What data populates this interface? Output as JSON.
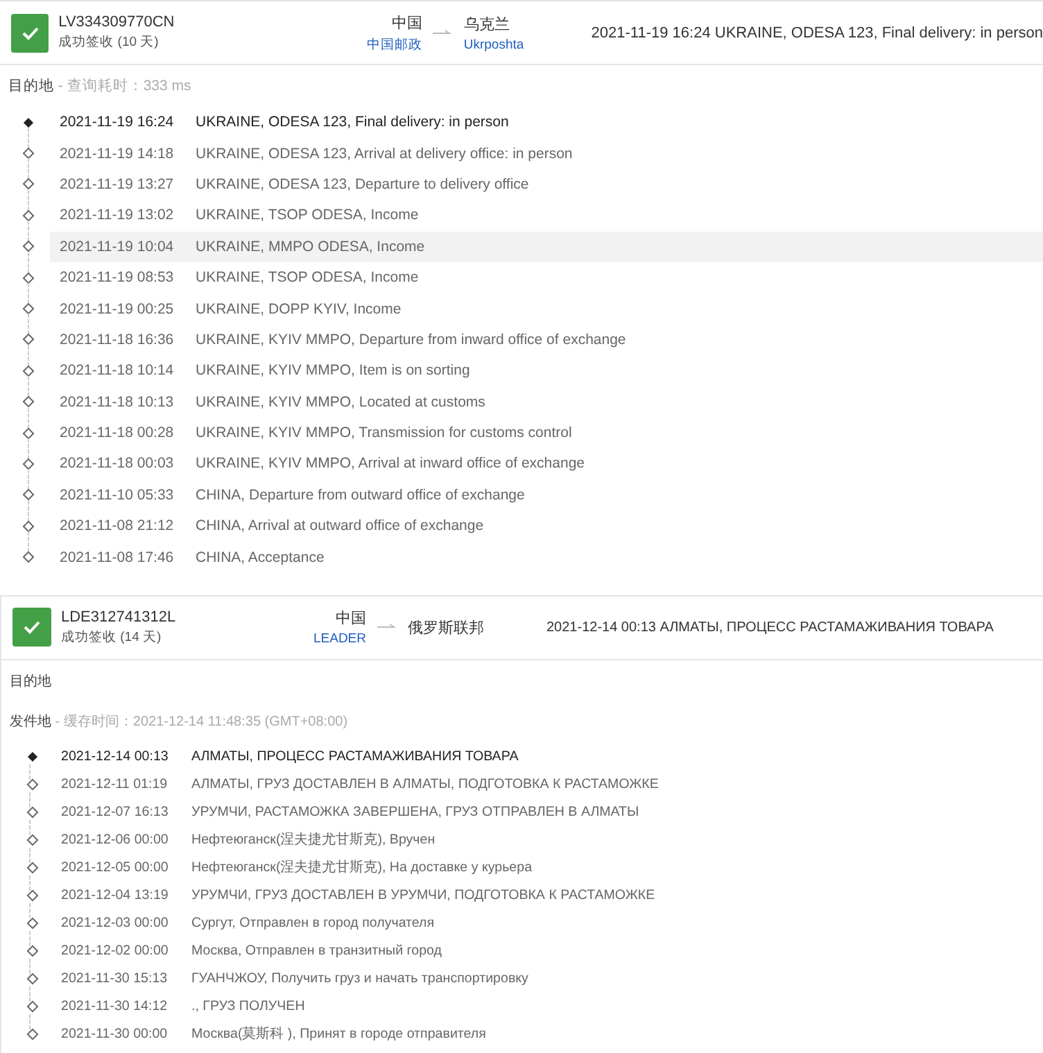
{
  "shipments": [
    {
      "tracking_number": "LV334309770CN",
      "status": "成功签收 (10 天)",
      "delivered": true,
      "origin": {
        "country": "中国",
        "carrier": "中国邮政"
      },
      "destination": {
        "country": "乌克兰",
        "carrier": "Ukrposhta"
      },
      "latest_event": "2021-11-19 16:24  UKRAINE, ODESA 123, Final delivery: in person",
      "sections": [
        {
          "label": "目的地",
          "note": " - 查询耗时：333 ms",
          "events": [
            {
              "time": "2021-11-19 16:24",
              "text": "UKRAINE, ODESA 123, Final delivery: in person",
              "latest": true,
              "highlighted": false
            },
            {
              "time": "2021-11-19 14:18",
              "text": "UKRAINE, ODESA 123, Arrival at delivery office: in person",
              "latest": false,
              "highlighted": false
            },
            {
              "time": "2021-11-19 13:27",
              "text": "UKRAINE, ODESA 123, Departure to delivery office",
              "latest": false,
              "highlighted": false
            },
            {
              "time": "2021-11-19 13:02",
              "text": "UKRAINE, TSOP ODESA, Income",
              "latest": false,
              "highlighted": false
            },
            {
              "time": "2021-11-19 10:04",
              "text": "UKRAINE, MMPO ODESA, Income",
              "latest": false,
              "highlighted": true
            },
            {
              "time": "2021-11-19 08:53",
              "text": "UKRAINE, TSOP ODESA, Income",
              "latest": false,
              "highlighted": false
            },
            {
              "time": "2021-11-19 00:25",
              "text": "UKRAINE, DOPP KYIV, Income",
              "latest": false,
              "highlighted": false
            },
            {
              "time": "2021-11-18 16:36",
              "text": "UKRAINE, KYIV MMPO, Departure from inward office of exchange",
              "latest": false,
              "highlighted": false
            },
            {
              "time": "2021-11-18 10:14",
              "text": "UKRAINE, KYIV MMPO, Item is on sorting",
              "latest": false,
              "highlighted": false
            },
            {
              "time": "2021-11-18 10:13",
              "text": "UKRAINE, KYIV MMPO, Located at customs",
              "latest": false,
              "highlighted": false
            },
            {
              "time": "2021-11-18 00:28",
              "text": "UKRAINE, KYIV MMPO, Transmission for customs control",
              "latest": false,
              "highlighted": false
            },
            {
              "time": "2021-11-18 00:03",
              "text": "UKRAINE, KYIV MMPO, Arrival at inward office of exchange",
              "latest": false,
              "highlighted": false
            },
            {
              "time": "2021-11-10 05:33",
              "text": "CHINA, Departure from outward office of exchange",
              "latest": false,
              "highlighted": false
            },
            {
              "time": "2021-11-08 21:12",
              "text": "CHINA, Arrival at outward office of exchange",
              "latest": false,
              "highlighted": false
            },
            {
              "time": "2021-11-08 17:46",
              "text": "CHINA, Acceptance",
              "latest": false,
              "highlighted": false
            }
          ]
        }
      ]
    },
    {
      "tracking_number": "LDE312741312L",
      "status": "成功签收 (14 天)",
      "delivered": true,
      "origin": {
        "country": "中国",
        "carrier": "LEADER"
      },
      "destination": {
        "country": "俄罗斯联邦"
      },
      "latest_event": "2021-12-14 00:13  АЛМАТЫ, ПРОЦЕСС РАСТАМАЖИВАНИЯ ТОВАРА",
      "sections": [
        {
          "label": "目的地"
        },
        {
          "label": "发件地",
          "note": " - 缓存时间：2021-12-14 11:48:35 (GMT+08:00)",
          "events": [
            {
              "time": "2021-12-14 00:13",
              "text": "АЛМАТЫ, ПРОЦЕСС РАСТАМАЖИВАНИЯ ТОВАРА",
              "latest": true,
              "highlighted": false
            },
            {
              "time": "2021-12-11 01:19",
              "text": "АЛМАТЫ, ГРУЗ ДОСТАВЛЕН В АЛМАТЫ, ПОДГОТОВКА К РАСТАМОЖКЕ",
              "latest": false,
              "highlighted": false
            },
            {
              "time": "2021-12-07 16:13",
              "text": "УРУМЧИ, РАСТАМОЖКА ЗАВЕРШЕНА, ГРУЗ ОТПРАВЛЕН В АЛМАТЫ",
              "latest": false,
              "highlighted": false
            },
            {
              "time": "2021-12-06 00:00",
              "text": "Нефтеюганск(涅夫捷尤甘斯克), Вручен",
              "latest": false,
              "highlighted": false
            },
            {
              "time": "2021-12-05 00:00",
              "text": "Нефтеюганск(涅夫捷尤甘斯克), На доставке у курьера",
              "latest": false,
              "highlighted": false
            },
            {
              "time": "2021-12-04 13:19",
              "text": "УРУМЧИ, ГРУЗ ДОСТАВЛЕН В УРУМЧИ, ПОДГОТОВКА К РАСТАМОЖКЕ",
              "latest": false,
              "highlighted": false
            },
            {
              "time": "2021-12-03 00:00",
              "text": "Сургут, Отправлен в город получателя",
              "latest": false,
              "highlighted": false
            },
            {
              "time": "2021-12-02 00:00",
              "text": "Москва, Отправлен в транзитный город",
              "latest": false,
              "highlighted": false
            },
            {
              "time": "2021-11-30 15:13",
              "text": "ГУАНЧЖОУ, Получить груз и начать транспортировку",
              "latest": false,
              "highlighted": false
            },
            {
              "time": "2021-11-30 14:12",
              "text": "., ГРУЗ ПОЛУЧЕН",
              "latest": false,
              "highlighted": false
            },
            {
              "time": "2021-11-30 00:00",
              "text": "Москва(莫斯科 ), Принят в городе отправителя",
              "latest": false,
              "highlighted": false
            }
          ]
        }
      ]
    }
  ]
}
